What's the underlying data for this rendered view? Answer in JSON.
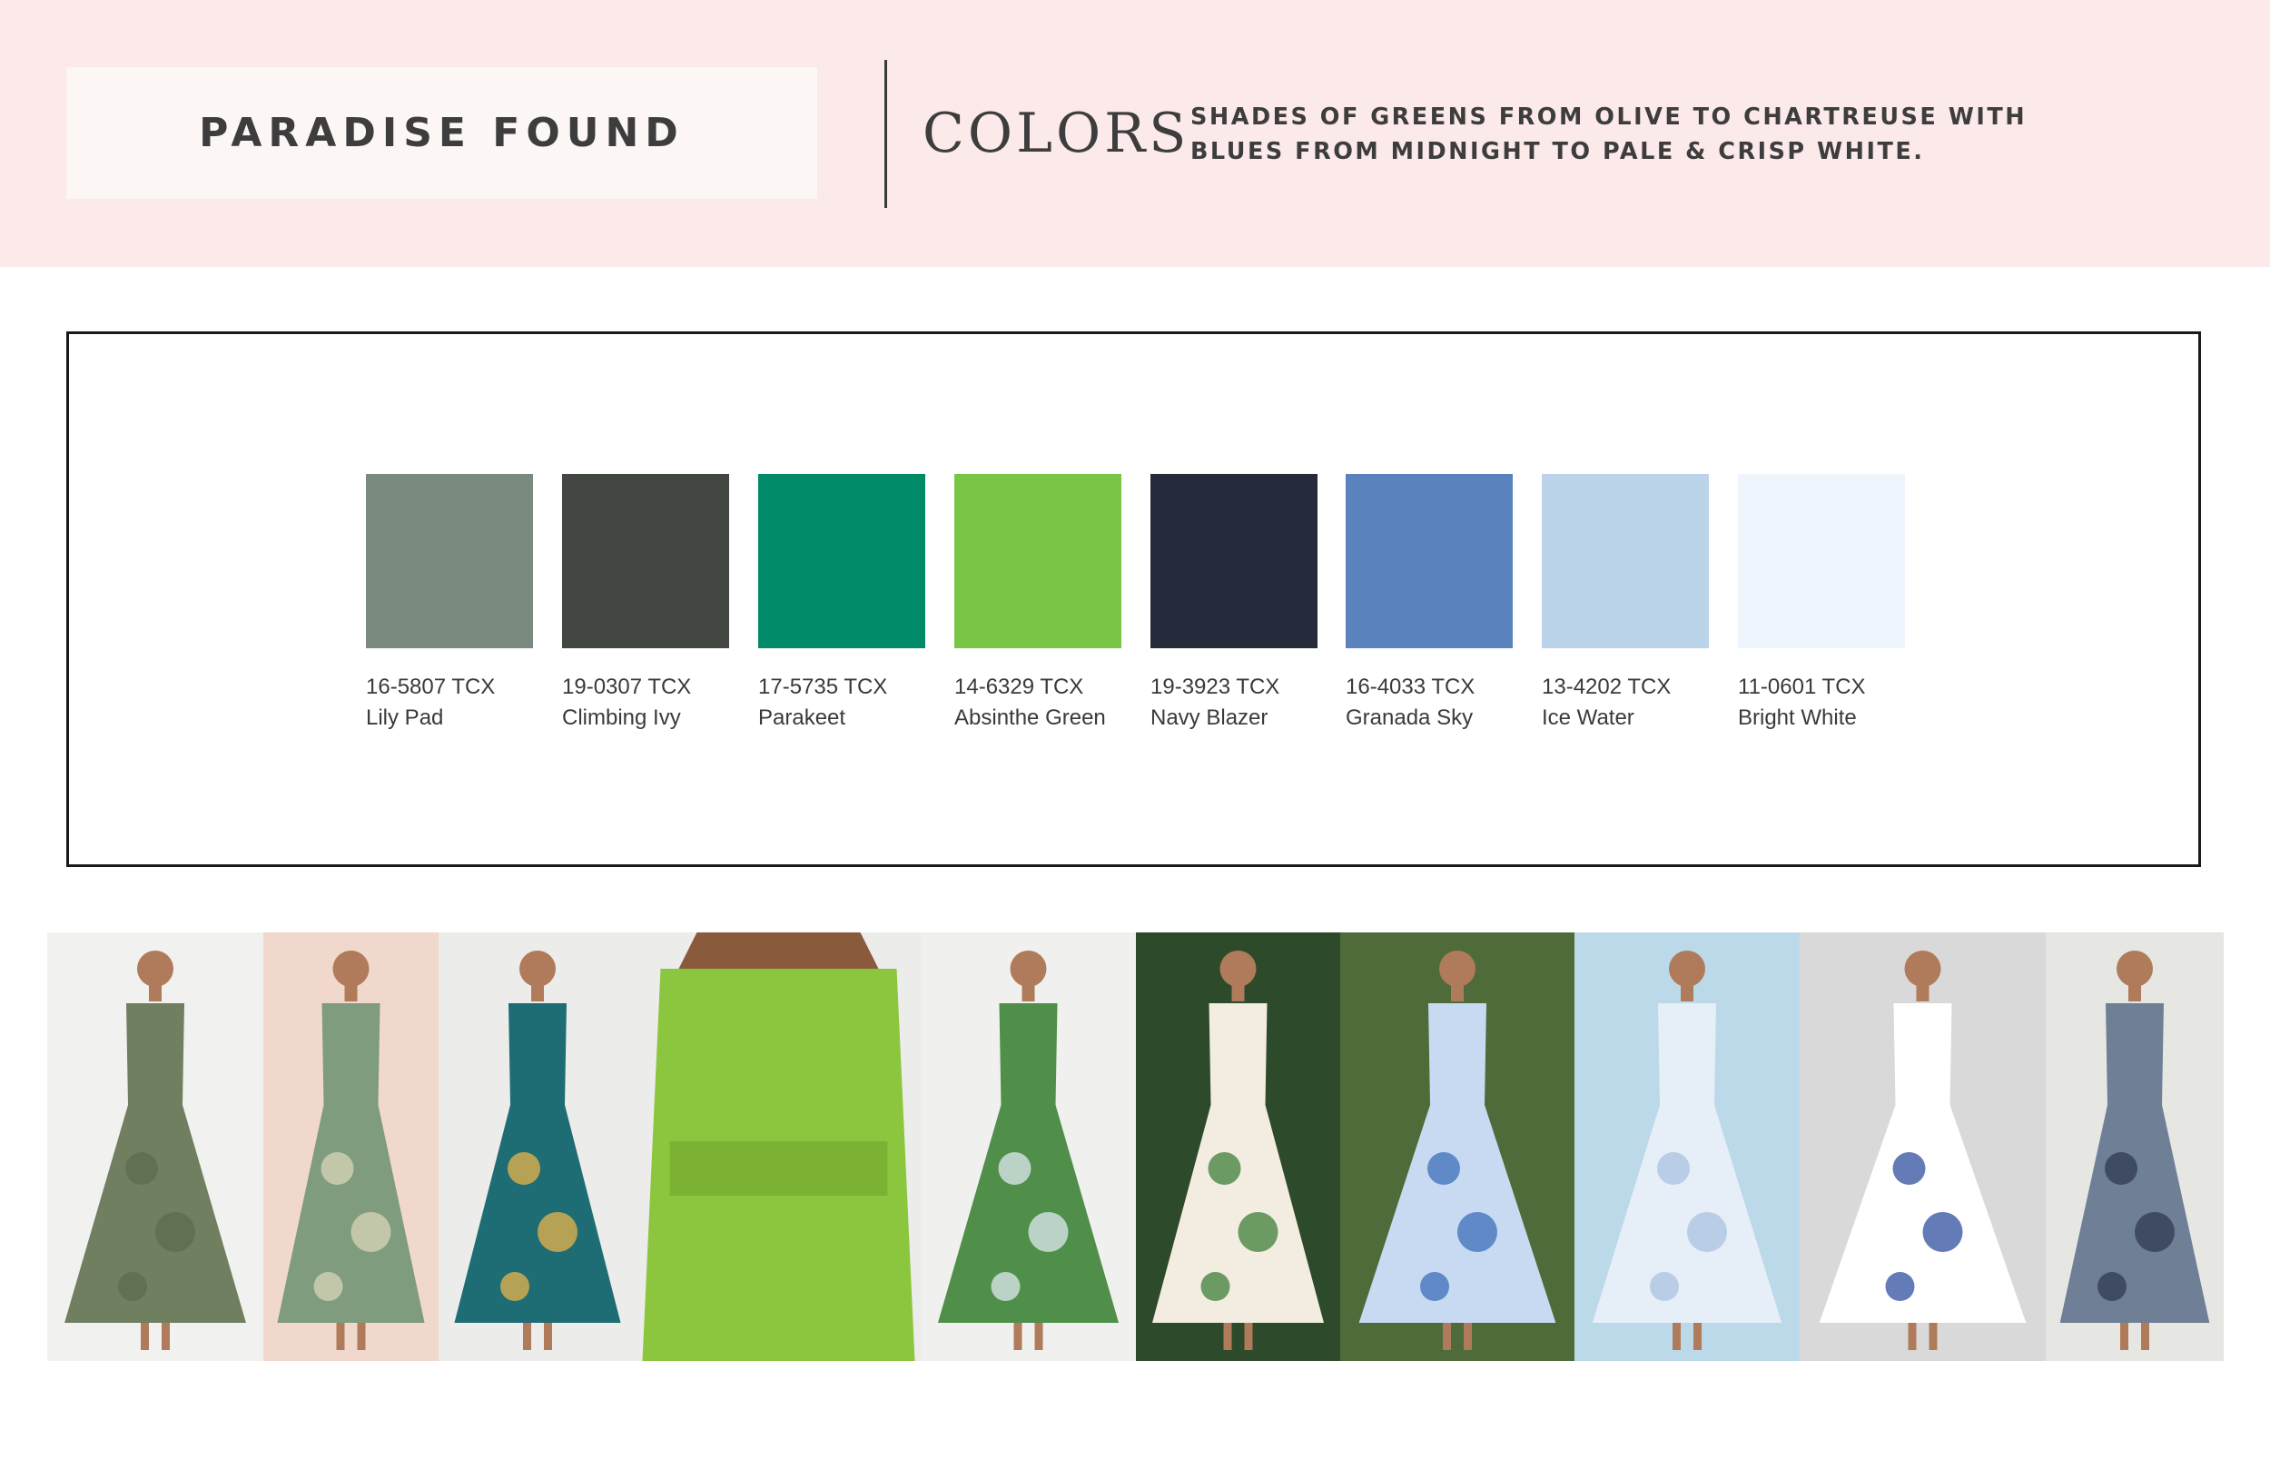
{
  "header": {
    "title": "PARADISE FOUND",
    "section_label": "COLORS",
    "description_lines": [
      "SHADES OF GREENS FROM OLIVE TO CHARTREUSE WITH",
      "BLUES FROM MIDNIGHT TO PALE & CRISP WHITE."
    ]
  },
  "swatches": [
    {
      "code": "16-5807 TCX",
      "name": "Lily Pad",
      "color": "#7a8a7f"
    },
    {
      "code": "19-0307 TCX",
      "name": "Climbing Ivy",
      "color": "#424841"
    },
    {
      "code": "17-5735 TCX",
      "name": "Parakeet",
      "color": "#008a68"
    },
    {
      "code": "14-6329 TCX",
      "name": "Absinthe Green",
      "color": "#79c646"
    },
    {
      "code": "19-3923 TCX",
      "name": "Navy Blazer",
      "color": "#252b3b"
    },
    {
      "code": "16-4033 TCX",
      "name": "Granada Sky",
      "color": "#5a82bc"
    },
    {
      "code": "13-4202 TCX",
      "name": "Ice Water",
      "color": "#bbd4ea"
    },
    {
      "code": "11-0601 TCX",
      "name": "Bright White",
      "color": "#eef5fc"
    }
  ],
  "photos": [
    {
      "subject": "olive-jumpsuit",
      "bg": "#f1f1ef",
      "garment": "#707f5f",
      "accent": "#5e6b4e"
    },
    {
      "subject": "green-print-skirt-set",
      "bg": "#f0d8cc",
      "garment": "#7f9c7e",
      "accent": "#d8d6b8"
    },
    {
      "subject": "teal-floral-mini-dress",
      "bg": "#ececea",
      "garment": "#1f6d74",
      "accent": "#e8b44a"
    },
    {
      "subject": "lime-eyelet-dress",
      "bg": "#ececea",
      "garment": "#8cc63f",
      "accent": "#6fa52b"
    },
    {
      "subject": "green-leaf-maxi-dress",
      "bg": "#f0f0ee",
      "garment": "#4f8f4a",
      "accent": "#dfe8f0"
    },
    {
      "subject": "tropical-print-maxi-dress",
      "bg": "#2d4a2a",
      "garment": "#f2ede0",
      "accent": "#3f7e3a"
    },
    {
      "subject": "blue-floral-midi-dress",
      "bg": "#4f6b3a",
      "garment": "#c7daf2",
      "accent": "#3e6fb8"
    },
    {
      "subject": "pale-blue-midi-dress",
      "bg": "#bcd9ea",
      "garment": "#e6eef8",
      "accent": "#a9c2e0"
    },
    {
      "subject": "blue-white-print-gown",
      "bg": "#d9d9d9",
      "garment": "#ffffff",
      "accent": "#2f4f9e"
    },
    {
      "subject": "gingham-maxi-dress",
      "bg": "#e6e6e3",
      "garment": "#6f7f96",
      "accent": "#2f3a52"
    }
  ]
}
